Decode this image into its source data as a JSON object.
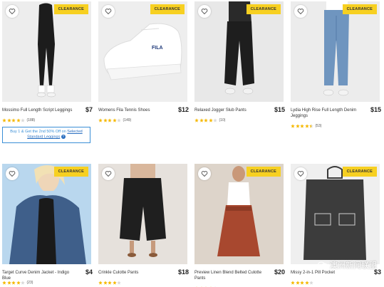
{
  "badge_label": "CLEARANCE",
  "products": [
    {
      "name": "Mossimo Full Length Script Leggings",
      "price": "$7",
      "rating": 4,
      "count": "(188)"
    },
    {
      "name": "Womens Fila Tennis Shoes",
      "price": "$12",
      "rating": 4,
      "count": "(149)"
    },
    {
      "name": "Relaxed Jogger Slub Pants",
      "price": "$15",
      "rating": 4,
      "count": "(10)"
    },
    {
      "name": "Lydia High Rise Full Length Denim Jeggings",
      "price": "$15",
      "rating": 4.5,
      "count": "(53)"
    },
    {
      "name": "Target Curve Denim Jacket - Indigo Blue",
      "price": "$4",
      "rating": 4,
      "count": "(23)"
    },
    {
      "name": "Crinkle Culotte Pants",
      "price": "$18",
      "rating": 4,
      "count": ""
    },
    {
      "name": "Preview Linen Blend Belted Culotte Pants",
      "price": "$20",
      "rating": 4,
      "count": ""
    },
    {
      "name": "Missy 2-in-1 Pill Pocket",
      "price": "$3",
      "rating": 4,
      "count": ""
    }
  ],
  "promo": {
    "line1": "Buy 1 & Get the 2nd 50% Off on",
    "link1": "Selected",
    "link2": "Standard Leggings"
  },
  "watermark": "澳洲新闻联盟",
  "colors": {
    "badge": "#f7d021",
    "star": "#f5b800",
    "promo_border": "#3a8fd6"
  }
}
